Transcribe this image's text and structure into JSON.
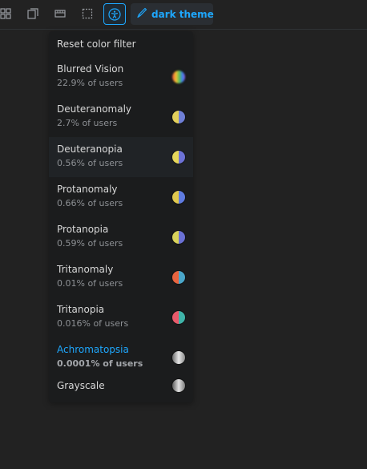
{
  "toolbar": {
    "icons": [
      "grid-icon",
      "outline-icon",
      "ruler-icon",
      "measure-icon",
      "accessibility-icon",
      "brush-icon"
    ],
    "theme_label": "dark theme"
  },
  "colors": {
    "accent": "#1ea7fd",
    "background": "#222222",
    "menu_bg": "#1b1c1d",
    "text": "#d8d8d8",
    "subtext": "#8d9094"
  },
  "filter_menu": {
    "reset_label": "Reset color filter",
    "items": [
      {
        "title": "Blurred Vision",
        "subtitle": "22.9% of users"
      },
      {
        "title": "Deuteranomaly",
        "subtitle": "2.7% of users"
      },
      {
        "title": "Deuteranopia",
        "subtitle": "0.56% of users"
      },
      {
        "title": "Protanomaly",
        "subtitle": "0.66% of users"
      },
      {
        "title": "Protanopia",
        "subtitle": "0.59% of users"
      },
      {
        "title": "Tritanomaly",
        "subtitle": "0.01% of users"
      },
      {
        "title": "Tritanopia",
        "subtitle": "0.016% of users"
      },
      {
        "title": "Achromatopsia",
        "subtitle": "0.0001% of users"
      },
      {
        "title": "Grayscale",
        "subtitle": ""
      }
    ],
    "selected": "Achromatopsia",
    "hovered": "Deuteranopia"
  }
}
